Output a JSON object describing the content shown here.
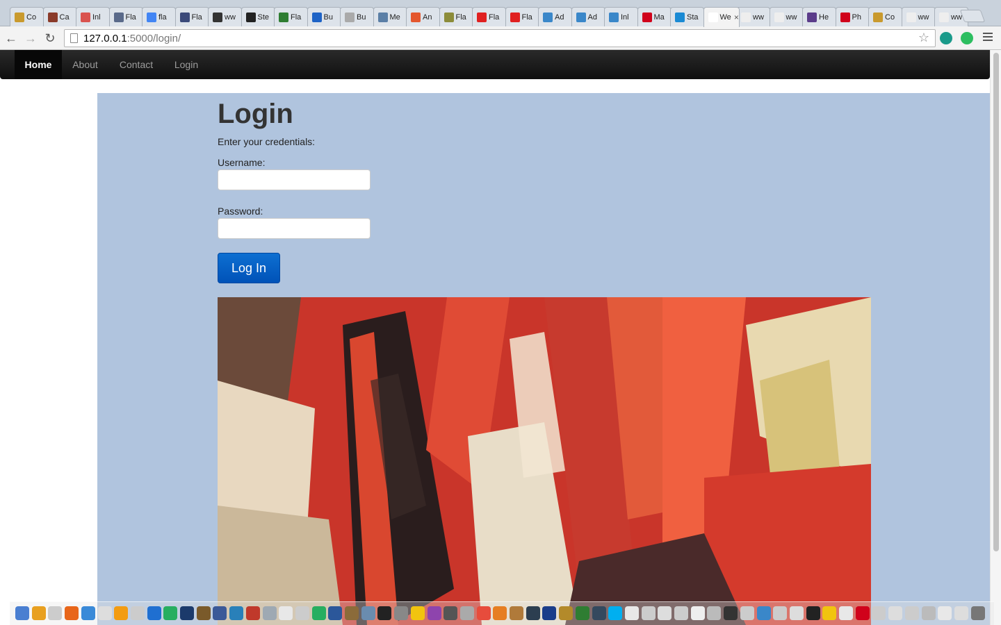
{
  "browser": {
    "tabs": [
      {
        "label": "Co",
        "color": "#c99a2e"
      },
      {
        "label": "Ca",
        "color": "#8a3b2a"
      },
      {
        "label": "Inl",
        "color": "#d9534f"
      },
      {
        "label": "Fla",
        "color": "#5a6a8a"
      },
      {
        "label": "fla",
        "color": "#4285f4"
      },
      {
        "label": "Fla",
        "color": "#3b4a7a"
      },
      {
        "label": "ww",
        "color": "#333333"
      },
      {
        "label": "Ste",
        "color": "#222222"
      },
      {
        "label": "Fla",
        "color": "#2e7d32"
      },
      {
        "label": "Bu",
        "color": "#1e63c6"
      },
      {
        "label": "Bu",
        "color": "#aaaaaa"
      },
      {
        "label": "Me",
        "color": "#5b7fa6"
      },
      {
        "label": "An",
        "color": "#e4572e"
      },
      {
        "label": "Fla",
        "color": "#8c8c3a"
      },
      {
        "label": "Fla",
        "color": "#e02020"
      },
      {
        "label": "Fla",
        "color": "#e02020"
      },
      {
        "label": "Ad",
        "color": "#3a87c9"
      },
      {
        "label": "Ad",
        "color": "#3a87c9"
      },
      {
        "label": "Inl",
        "color": "#3a87c9"
      },
      {
        "label": "Ma",
        "color": "#d0021b"
      },
      {
        "label": "Sta",
        "color": "#1a8ad4"
      },
      {
        "label": "We",
        "color": "#ffffff",
        "active": true
      },
      {
        "label": "ww",
        "color": "#eeeeee"
      },
      {
        "label": "ww",
        "color": "#eeeeee"
      },
      {
        "label": "He",
        "color": "#5b3c8a"
      },
      {
        "label": "Ph",
        "color": "#d0021b"
      },
      {
        "label": "Co",
        "color": "#c99a2e"
      },
      {
        "label": "ww",
        "color": "#eeeeee"
      },
      {
        "label": "ww",
        "color": "#eeeeee"
      }
    ],
    "url_host": "127.0.0.1",
    "url_path": ":5000/login/",
    "extension_colors": [
      "#1a9a8a",
      "#2dbe60"
    ]
  },
  "navbar": {
    "items": [
      {
        "label": "Home",
        "active": true
      },
      {
        "label": "About"
      },
      {
        "label": "Contact"
      },
      {
        "label": "Login"
      }
    ]
  },
  "login": {
    "title": "Login",
    "subtitle": "Enter your credentials:",
    "username_label": "Username:",
    "username_value": "",
    "password_label": "Password:",
    "password_value": "",
    "button_label": "Log In"
  },
  "colors": {
    "content_bg": "#b0c4de",
    "button_blue": "#0a62c8",
    "navbar_bg": "#1b1b1b"
  },
  "dock": {
    "icon_colors": [
      "#4a7fd1",
      "#e8a020",
      "#cccccc",
      "#e8661a",
      "#3a8ad8",
      "#dddddd",
      "#f39c12",
      "#cccccc",
      "#1f6fd1",
      "#27ae60",
      "#1b3a6b",
      "#7a5a2a",
      "#3b5998",
      "#2980b9",
      "#c0392b",
      "#9ea9b3",
      "#e8e8e8",
      "#cccccc",
      "#27ae60",
      "#2b579a",
      "#8b6b3a",
      "#6a8caf",
      "#222222",
      "#888888",
      "#f1c40f",
      "#8e44ad",
      "#555555",
      "#aaaaaa",
      "#e74c3c",
      "#e67e22",
      "#b07a3a",
      "#2c3e50",
      "#1a3d8a",
      "#b38a2a",
      "#2e7d32",
      "#34495e",
      "#00aff0",
      "#e8e8e8",
      "#cccccc",
      "#dddddd",
      "#cccccc",
      "#eeeeee",
      "#bbbbbb",
      "#333333",
      "#cccccc",
      "#3a87c9",
      "#cccccc",
      "#dddddd",
      "#222222",
      "#f1c40f",
      "#e8e8e8",
      "#d0021b",
      "#cccccc",
      "#dddddd",
      "#cccccc",
      "#bbbbbb",
      "#e8e8e8",
      "#dddddd",
      "#777777"
    ]
  }
}
